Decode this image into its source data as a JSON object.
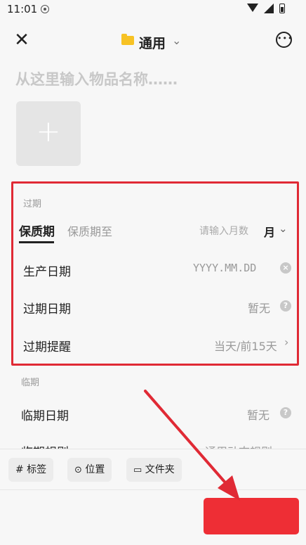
{
  "status_bar": {
    "time": "11:01",
    "icons": [
      "shield-icon",
      "wifi-icon",
      "signal-icon",
      "battery-icon"
    ]
  },
  "top_bar": {
    "folder_label": "通用",
    "icons": [
      "close-icon",
      "folder-icon",
      "chevron-down-icon",
      "more-icon"
    ]
  },
  "name_input": {
    "placeholder": "从这里输入物品名称……",
    "value": ""
  },
  "expire_section": {
    "title": "过期",
    "tab_shelf_life": "保质期",
    "tab_shelf_until": "保质期至",
    "months_placeholder": "请输入月数",
    "unit": "月",
    "rows": [
      {
        "label": "生产日期",
        "value": "YYYY.MM.DD"
      },
      {
        "label": "过期日期",
        "value": "暂无"
      },
      {
        "label": "过期提醒",
        "value": "当天/前15天"
      }
    ]
  },
  "near_section": {
    "title": "临期",
    "rows": [
      {
        "label": "临期日期",
        "value": "暂无"
      },
      {
        "label": "临期规则",
        "value": "通用动态规则"
      }
    ]
  },
  "bottom_bar": {
    "tag_label": "# 标签",
    "location_label": "位置",
    "folder_label": "文件夹"
  },
  "annotation": {
    "highlight_color": "#e02a35",
    "arrow_color": "#e02a35"
  }
}
